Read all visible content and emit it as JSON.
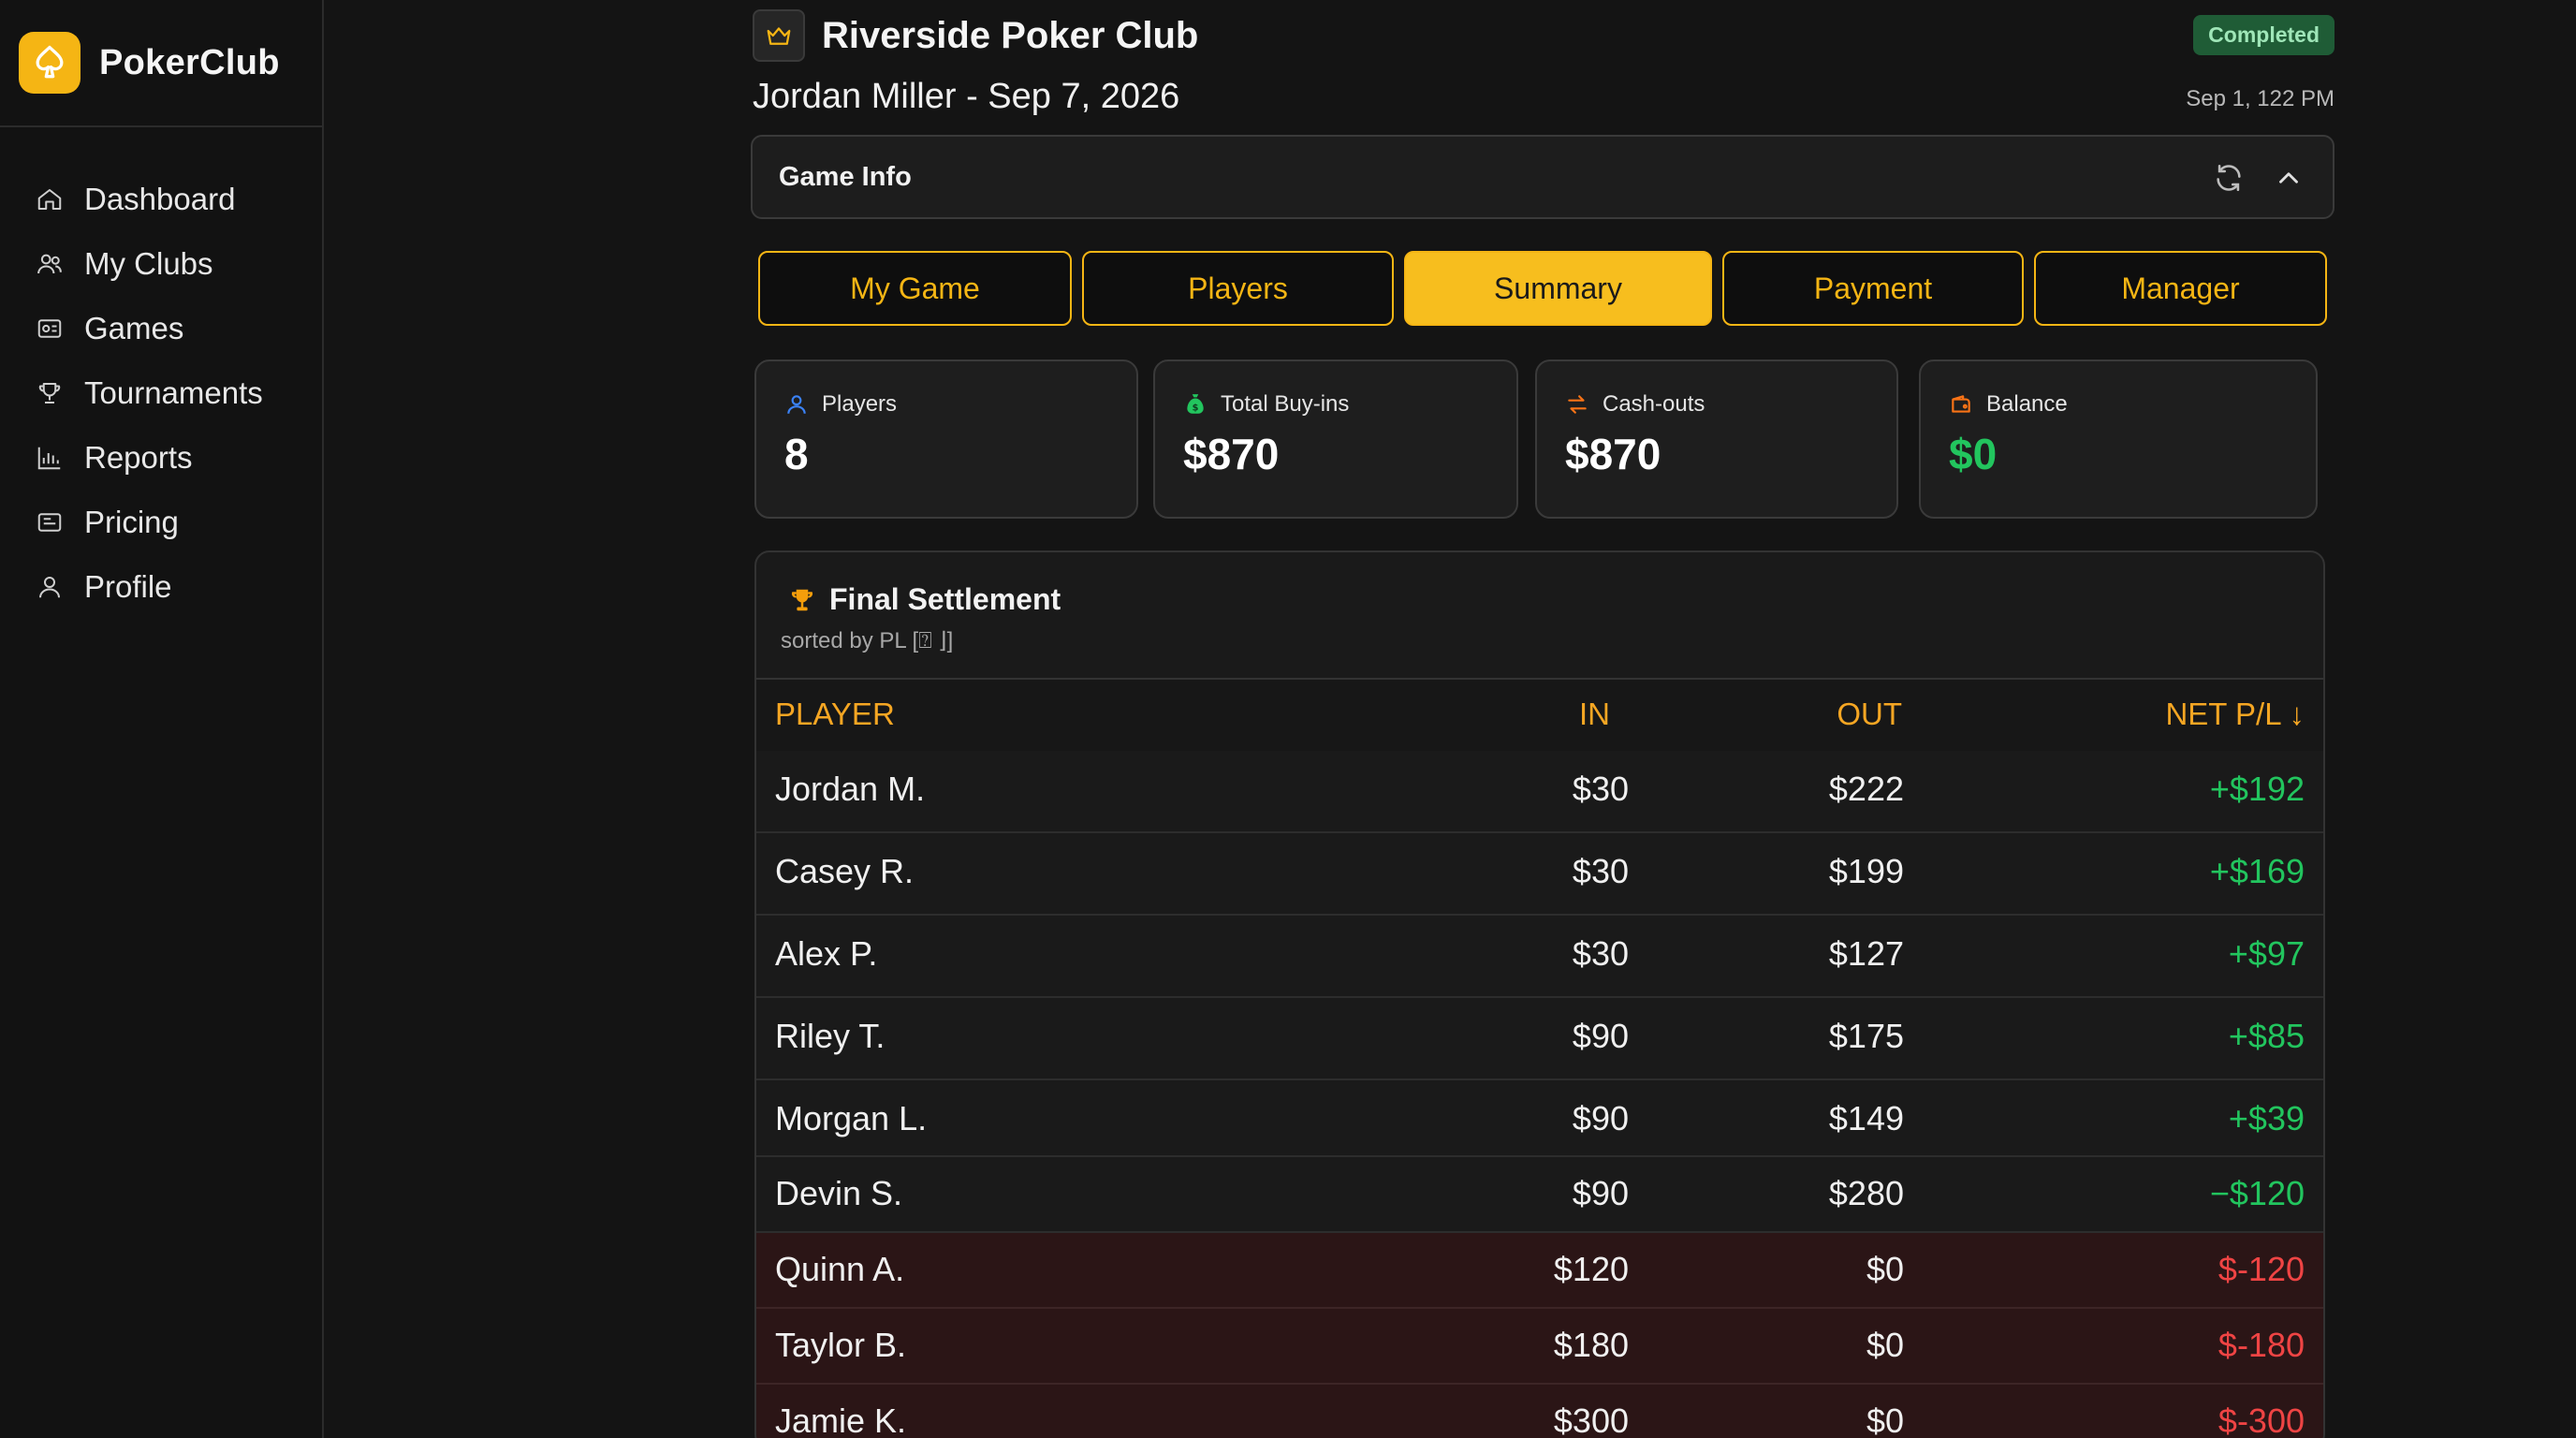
{
  "app": {
    "name": "PokerClub"
  },
  "sidebar": {
    "items": [
      {
        "label": "Dashboard",
        "icon": "home-icon"
      },
      {
        "label": "My Clubs",
        "icon": "users-icon"
      },
      {
        "label": "Games",
        "icon": "cards-icon"
      },
      {
        "label": "Tournaments",
        "icon": "trophy-icon"
      },
      {
        "label": "Reports",
        "icon": "chart-icon"
      },
      {
        "label": "Pricing",
        "icon": "tag-icon"
      },
      {
        "label": "Profile",
        "icon": "user-icon"
      }
    ]
  },
  "header": {
    "club_name": "Riverside Poker Club",
    "status": "Completed",
    "game_subtitle": "Jordan Miller - Sep 7, 2026",
    "date": "Sep 1, 122 PM"
  },
  "game_info": {
    "title": "Game Info"
  },
  "tabs": [
    {
      "label": "My Game",
      "active": false
    },
    {
      "label": "Players",
      "active": false
    },
    {
      "label": "Summary",
      "active": true
    },
    {
      "label": "Payment",
      "active": false
    },
    {
      "label": "Manager",
      "active": false
    }
  ],
  "stats": [
    {
      "label": "Players",
      "value": "8",
      "icon": "person-icon",
      "color": "#3b82f6"
    },
    {
      "label": "Total Buy-ins",
      "value": "$870",
      "icon": "money-bag-icon",
      "color": "#22c55e"
    },
    {
      "label": "Cash-outs",
      "value": "$870",
      "icon": "exchange-icon",
      "color": "#f97316"
    },
    {
      "label": "Balance",
      "value": "$0",
      "icon": "wallet-icon",
      "color": "#f97316"
    }
  ],
  "settlement": {
    "title": "Final Settlement",
    "subtitle": "sorted by PL [⍰ ⌋]",
    "columns": {
      "player": "PLAYER",
      "in": "IN",
      "out": "OUT",
      "net": "NET P/L ↓"
    },
    "rows": [
      {
        "player": "Jordan M.",
        "in": "$30",
        "out": "$222",
        "net": "+$192",
        "negative": false
      },
      {
        "player": "Casey R.",
        "in": "$30",
        "out": "$199",
        "net": "+$169",
        "negative": false
      },
      {
        "player": "Alex P.",
        "in": "$30",
        "out": "$127",
        "net": "+$97",
        "negative": false
      },
      {
        "player": "Riley T.",
        "in": "$90",
        "out": "$175",
        "net": "+$85",
        "negative": false
      },
      {
        "player": "Morgan L.",
        "in": "$90",
        "out": "$149",
        "net": "+$39",
        "negative": false
      },
      {
        "player": "Devin S.",
        "in": "$90",
        "out": "$280",
        "net": "−$120",
        "negative": false
      },
      {
        "player": "Quinn A.",
        "in": "$120",
        "out": "$0",
        "net": "$-120",
        "negative": true
      },
      {
        "player": "Taylor B.",
        "in": "$180",
        "out": "$0",
        "net": "$-180",
        "negative": true
      },
      {
        "player": "Jamie K.",
        "in": "$300",
        "out": "$0",
        "net": "$-300",
        "negative": true
      }
    ]
  },
  "colors": {
    "accent": "#f5b514",
    "positive": "#22c55e",
    "negative": "#ef4444",
    "header_text": "#f5a623",
    "badge_bg": "#1f5c36"
  }
}
